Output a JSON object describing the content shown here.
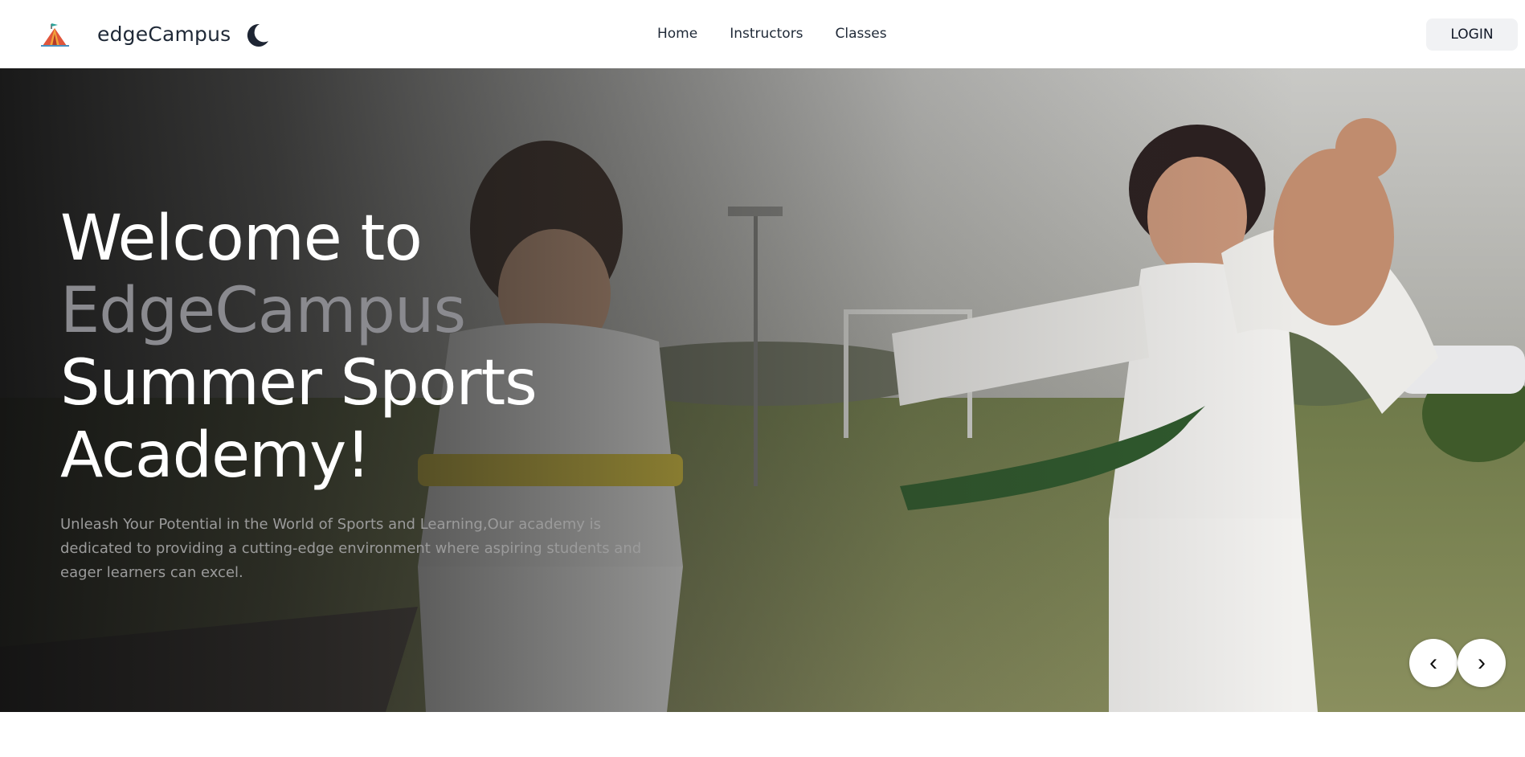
{
  "navbar": {
    "brand": "edgeCampus",
    "links": [
      "Home",
      "Instructors",
      "Classes"
    ],
    "login_label": "LOGIN"
  },
  "hero": {
    "title_line1": "Welcome to",
    "title_line2": "EdgeCampus",
    "title_line3": "Summer Sports",
    "title_line4": "Academy!",
    "description": "Unleash Your Potential in the World of Sports and Learning,Our academy is dedicated to providing a cutting-edge environment where aspiring students and eager learners can excel.",
    "prev_label": "‹",
    "next_label": "›"
  },
  "colors": {
    "accent_text": "#8a8a8f",
    "login_bg": "#f1f2f4"
  },
  "icons": {
    "logo": "tent-logo-icon",
    "theme_toggle": "moon-icon"
  }
}
